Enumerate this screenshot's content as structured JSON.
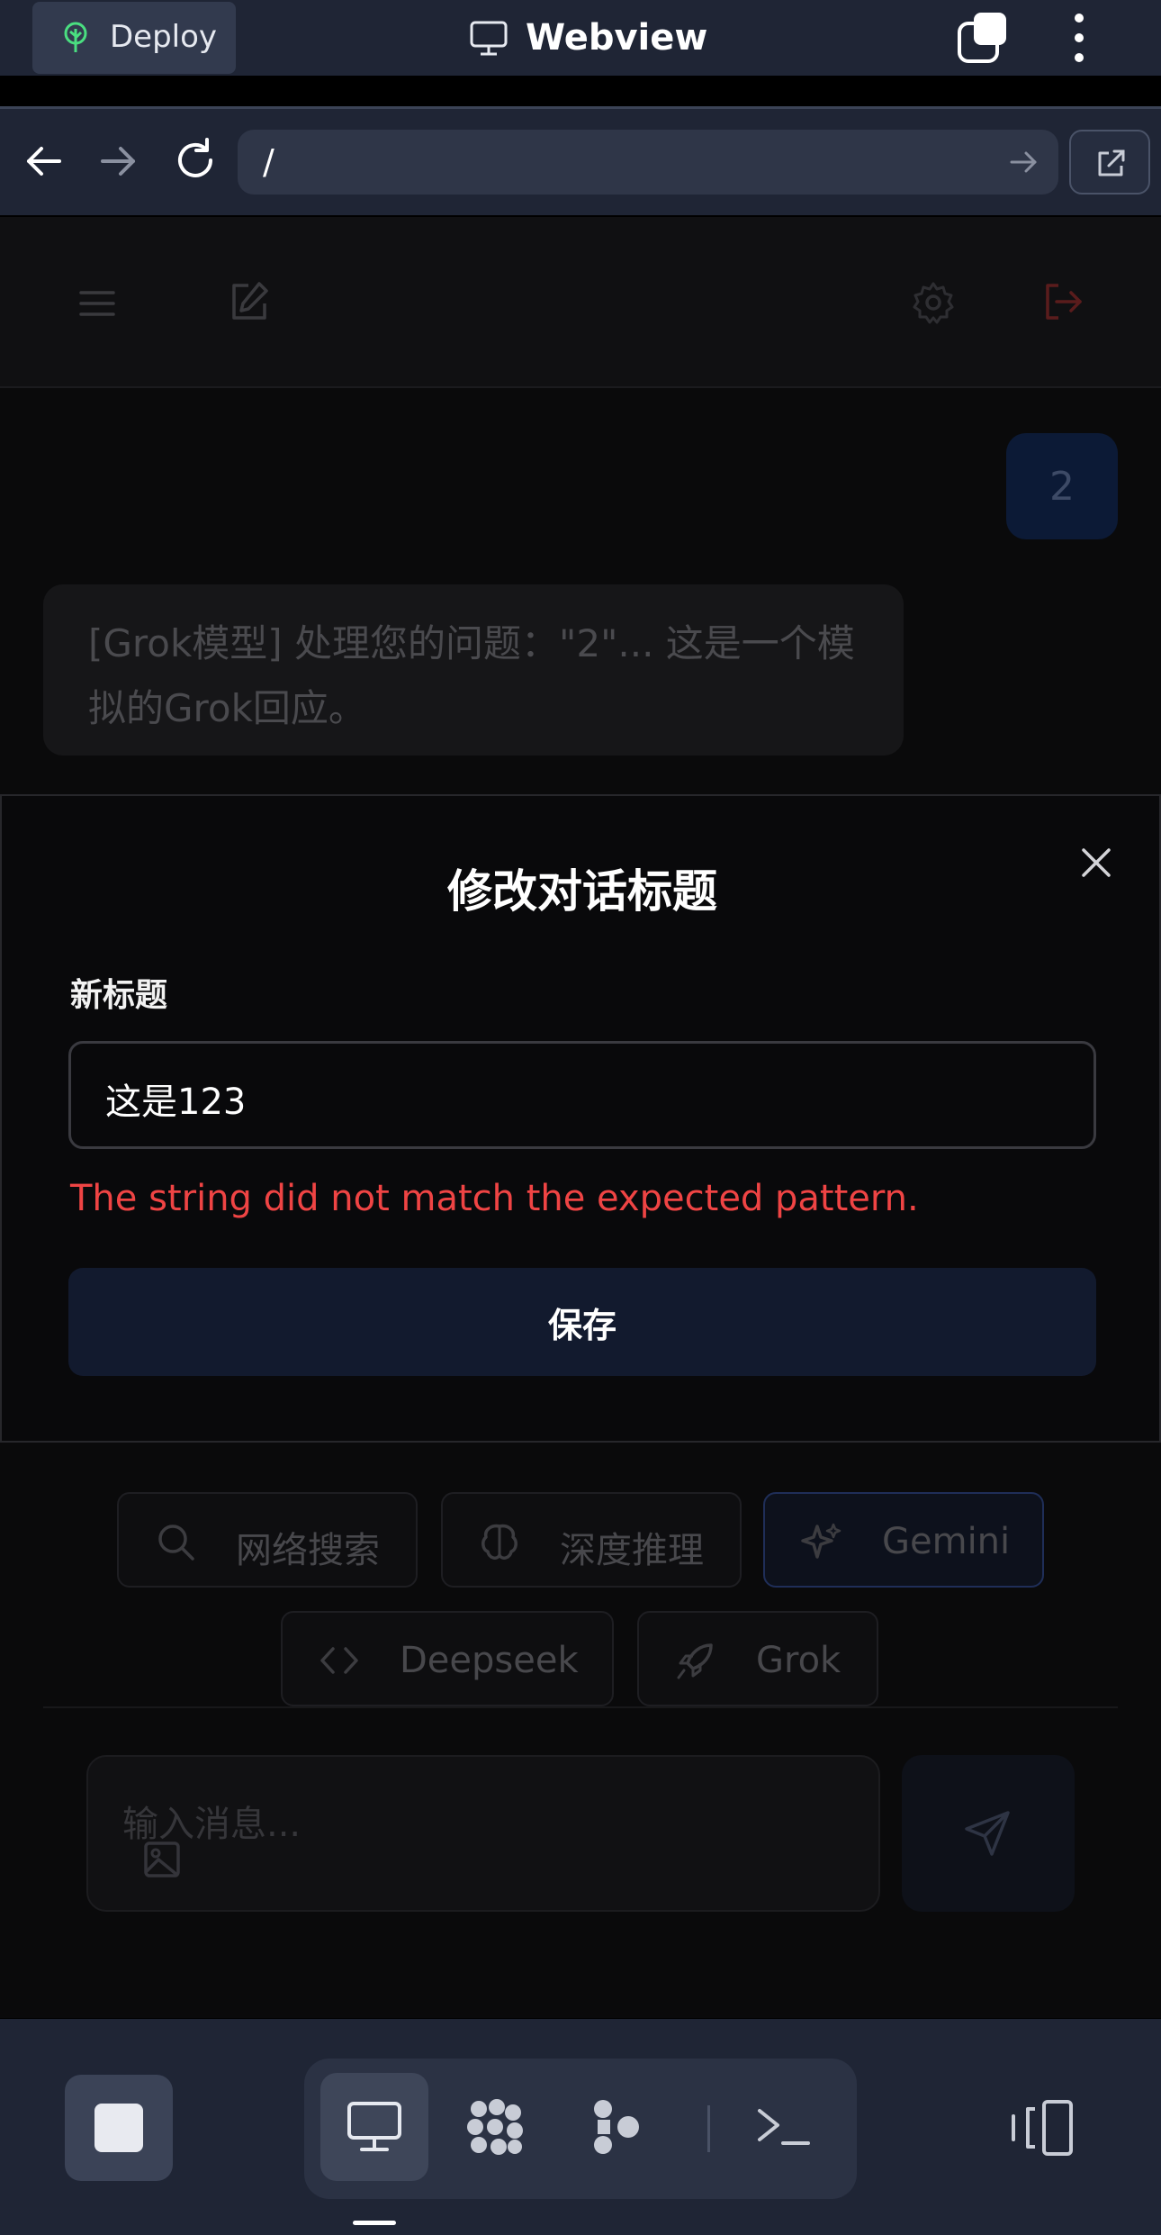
{
  "host": {
    "deploy_label": "Deploy",
    "title": "Webview",
    "url": "/"
  },
  "chat": {
    "user_message": "2",
    "bot_message": "[Grok模型] 处理您的问题：\"2\"... 这是一个模拟的Grok回应。",
    "chips": [
      {
        "label": "网络搜索",
        "icon": "search-icon"
      },
      {
        "label": "深度推理",
        "icon": "brain-icon"
      },
      {
        "label": "Gemini",
        "icon": "sparkles-icon",
        "active": true
      },
      {
        "label": "Deepseek",
        "icon": "code-icon"
      },
      {
        "label": "Grok",
        "icon": "rocket-icon"
      }
    ],
    "input_placeholder": "输入消息..."
  },
  "modal": {
    "title": "修改对话标题",
    "field_label": "新标题",
    "field_value": "这是123",
    "error": "The string did not match the expected pattern.",
    "save_label": "保存"
  },
  "colors": {
    "error": "#ef4444",
    "host_bg": "#1f2535",
    "accent_chip_border": "#1f2e58"
  }
}
